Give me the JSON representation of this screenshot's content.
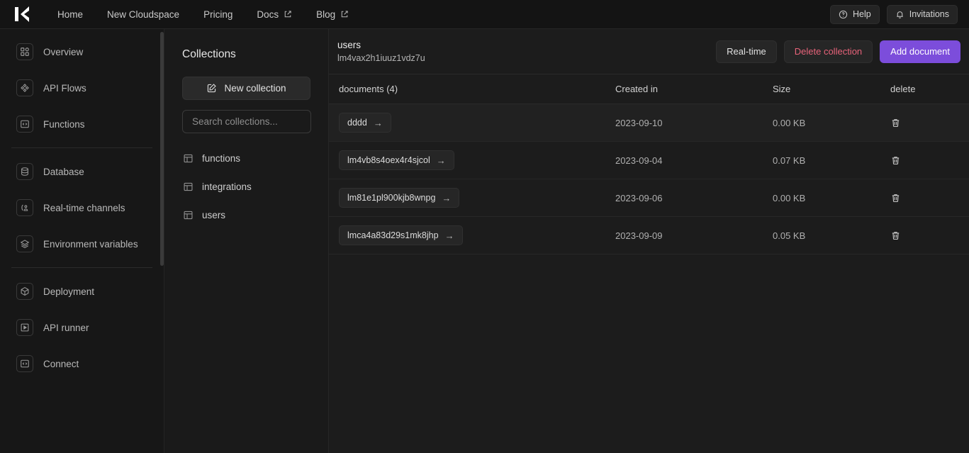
{
  "brand": {
    "logo_letter": "K",
    "accent_color": "#7c4ddb",
    "danger_color": "#e8637a"
  },
  "navbar": {
    "links": [
      {
        "label": "Home",
        "external": false,
        "icon": ""
      },
      {
        "label": "New Cloudspace",
        "external": false,
        "icon": ""
      },
      {
        "label": "Pricing",
        "external": false,
        "icon": ""
      },
      {
        "label": "Docs",
        "external": true,
        "icon": "external-link-icon"
      },
      {
        "label": "Blog",
        "external": true,
        "icon": "external-link-icon"
      }
    ],
    "help_label": "Help",
    "help_icon": "question-circle-icon",
    "invitations_label": "Invitations",
    "invitations_icon": "bell-icon"
  },
  "sidebar": {
    "items": [
      {
        "label": "Overview",
        "icon": "grid-icon"
      },
      {
        "label": "API Flows",
        "icon": "flows-icon"
      },
      {
        "label": "Functions",
        "icon": "code-icon"
      },
      {
        "label": "Database",
        "icon": "database-icon"
      },
      {
        "label": "Real-time channels",
        "icon": "broadcast-icon"
      },
      {
        "label": "Environment variables",
        "icon": "layers-icon"
      },
      {
        "label": "Deployment",
        "icon": "cube-icon"
      },
      {
        "label": "API runner",
        "icon": "play-icon"
      },
      {
        "label": "Connect",
        "icon": "code-brackets-icon"
      }
    ]
  },
  "collections_panel": {
    "title": "Collections",
    "new_collection_label": "New collection",
    "new_collection_icon": "pencil-square-icon",
    "search_placeholder": "Search collections...",
    "search_value": "",
    "items": [
      {
        "label": "functions",
        "icon": "table-icon"
      },
      {
        "label": "integrations",
        "icon": "table-icon"
      },
      {
        "label": "users",
        "icon": "table-icon"
      }
    ]
  },
  "main": {
    "title": "users",
    "subtitle": "lm4vax2h1iuuz1vdz7u",
    "actions": {
      "realtime_label": "Real-time",
      "delete_collection_label": "Delete collection",
      "add_document_label": "Add document"
    },
    "table": {
      "headers": {
        "documents": "documents (4)",
        "created": "Created in",
        "size": "Size",
        "delete": "delete"
      },
      "delete_icon": "trash-icon",
      "chip_icon": "arrow-right-icon",
      "rows": [
        {
          "id": "dddd",
          "created": "2023-09-10",
          "size": "0.00 KB",
          "hover": true
        },
        {
          "id": "lm4vb8s4oex4r4sjcol",
          "created": "2023-09-04",
          "size": "0.07 KB",
          "hover": false
        },
        {
          "id": "lm81e1pl900kjb8wnpg",
          "created": "2023-09-06",
          "size": "0.00 KB",
          "hover": false
        },
        {
          "id": "lmca4a83d29s1mk8jhp",
          "created": "2023-09-09",
          "size": "0.05 KB",
          "hover": false
        }
      ]
    }
  }
}
